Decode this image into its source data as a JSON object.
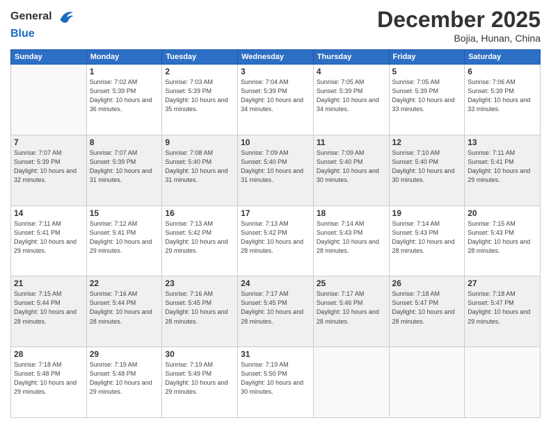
{
  "logo": {
    "general": "General",
    "blue": "Blue"
  },
  "title": {
    "month": "December 2025",
    "location": "Bojia, Hunan, China"
  },
  "weekdays": [
    "Sunday",
    "Monday",
    "Tuesday",
    "Wednesday",
    "Thursday",
    "Friday",
    "Saturday"
  ],
  "weeks": [
    {
      "striped": false,
      "days": [
        {
          "num": "",
          "empty": true,
          "sunrise": "",
          "sunset": "",
          "daylight": ""
        },
        {
          "num": "1",
          "empty": false,
          "sunrise": "Sunrise: 7:02 AM",
          "sunset": "Sunset: 5:39 PM",
          "daylight": "Daylight: 10 hours and 36 minutes."
        },
        {
          "num": "2",
          "empty": false,
          "sunrise": "Sunrise: 7:03 AM",
          "sunset": "Sunset: 5:39 PM",
          "daylight": "Daylight: 10 hours and 35 minutes."
        },
        {
          "num": "3",
          "empty": false,
          "sunrise": "Sunrise: 7:04 AM",
          "sunset": "Sunset: 5:39 PM",
          "daylight": "Daylight: 10 hours and 34 minutes."
        },
        {
          "num": "4",
          "empty": false,
          "sunrise": "Sunrise: 7:05 AM",
          "sunset": "Sunset: 5:39 PM",
          "daylight": "Daylight: 10 hours and 34 minutes."
        },
        {
          "num": "5",
          "empty": false,
          "sunrise": "Sunrise: 7:05 AM",
          "sunset": "Sunset: 5:39 PM",
          "daylight": "Daylight: 10 hours and 33 minutes."
        },
        {
          "num": "6",
          "empty": false,
          "sunrise": "Sunrise: 7:06 AM",
          "sunset": "Sunset: 5:39 PM",
          "daylight": "Daylight: 10 hours and 33 minutes."
        }
      ]
    },
    {
      "striped": true,
      "days": [
        {
          "num": "7",
          "empty": false,
          "sunrise": "Sunrise: 7:07 AM",
          "sunset": "Sunset: 5:39 PM",
          "daylight": "Daylight: 10 hours and 32 minutes."
        },
        {
          "num": "8",
          "empty": false,
          "sunrise": "Sunrise: 7:07 AM",
          "sunset": "Sunset: 5:39 PM",
          "daylight": "Daylight: 10 hours and 31 minutes."
        },
        {
          "num": "9",
          "empty": false,
          "sunrise": "Sunrise: 7:08 AM",
          "sunset": "Sunset: 5:40 PM",
          "daylight": "Daylight: 10 hours and 31 minutes."
        },
        {
          "num": "10",
          "empty": false,
          "sunrise": "Sunrise: 7:09 AM",
          "sunset": "Sunset: 5:40 PM",
          "daylight": "Daylight: 10 hours and 31 minutes."
        },
        {
          "num": "11",
          "empty": false,
          "sunrise": "Sunrise: 7:09 AM",
          "sunset": "Sunset: 5:40 PM",
          "daylight": "Daylight: 10 hours and 30 minutes."
        },
        {
          "num": "12",
          "empty": false,
          "sunrise": "Sunrise: 7:10 AM",
          "sunset": "Sunset: 5:40 PM",
          "daylight": "Daylight: 10 hours and 30 minutes."
        },
        {
          "num": "13",
          "empty": false,
          "sunrise": "Sunrise: 7:11 AM",
          "sunset": "Sunset: 5:41 PM",
          "daylight": "Daylight: 10 hours and 29 minutes."
        }
      ]
    },
    {
      "striped": false,
      "days": [
        {
          "num": "14",
          "empty": false,
          "sunrise": "Sunrise: 7:11 AM",
          "sunset": "Sunset: 5:41 PM",
          "daylight": "Daylight: 10 hours and 29 minutes."
        },
        {
          "num": "15",
          "empty": false,
          "sunrise": "Sunrise: 7:12 AM",
          "sunset": "Sunset: 5:41 PM",
          "daylight": "Daylight: 10 hours and 29 minutes."
        },
        {
          "num": "16",
          "empty": false,
          "sunrise": "Sunrise: 7:13 AM",
          "sunset": "Sunset: 5:42 PM",
          "daylight": "Daylight: 10 hours and 29 minutes."
        },
        {
          "num": "17",
          "empty": false,
          "sunrise": "Sunrise: 7:13 AM",
          "sunset": "Sunset: 5:42 PM",
          "daylight": "Daylight: 10 hours and 28 minutes."
        },
        {
          "num": "18",
          "empty": false,
          "sunrise": "Sunrise: 7:14 AM",
          "sunset": "Sunset: 5:43 PM",
          "daylight": "Daylight: 10 hours and 28 minutes."
        },
        {
          "num": "19",
          "empty": false,
          "sunrise": "Sunrise: 7:14 AM",
          "sunset": "Sunset: 5:43 PM",
          "daylight": "Daylight: 10 hours and 28 minutes."
        },
        {
          "num": "20",
          "empty": false,
          "sunrise": "Sunrise: 7:15 AM",
          "sunset": "Sunset: 5:43 PM",
          "daylight": "Daylight: 10 hours and 28 minutes."
        }
      ]
    },
    {
      "striped": true,
      "days": [
        {
          "num": "21",
          "empty": false,
          "sunrise": "Sunrise: 7:15 AM",
          "sunset": "Sunset: 5:44 PM",
          "daylight": "Daylight: 10 hours and 28 minutes."
        },
        {
          "num": "22",
          "empty": false,
          "sunrise": "Sunrise: 7:16 AM",
          "sunset": "Sunset: 5:44 PM",
          "daylight": "Daylight: 10 hours and 28 minutes."
        },
        {
          "num": "23",
          "empty": false,
          "sunrise": "Sunrise: 7:16 AM",
          "sunset": "Sunset: 5:45 PM",
          "daylight": "Daylight: 10 hours and 28 minutes."
        },
        {
          "num": "24",
          "empty": false,
          "sunrise": "Sunrise: 7:17 AM",
          "sunset": "Sunset: 5:45 PM",
          "daylight": "Daylight: 10 hours and 28 minutes."
        },
        {
          "num": "25",
          "empty": false,
          "sunrise": "Sunrise: 7:17 AM",
          "sunset": "Sunset: 5:46 PM",
          "daylight": "Daylight: 10 hours and 28 minutes."
        },
        {
          "num": "26",
          "empty": false,
          "sunrise": "Sunrise: 7:18 AM",
          "sunset": "Sunset: 5:47 PM",
          "daylight": "Daylight: 10 hours and 28 minutes."
        },
        {
          "num": "27",
          "empty": false,
          "sunrise": "Sunrise: 7:18 AM",
          "sunset": "Sunset: 5:47 PM",
          "daylight": "Daylight: 10 hours and 29 minutes."
        }
      ]
    },
    {
      "striped": false,
      "days": [
        {
          "num": "28",
          "empty": false,
          "sunrise": "Sunrise: 7:18 AM",
          "sunset": "Sunset: 5:48 PM",
          "daylight": "Daylight: 10 hours and 29 minutes."
        },
        {
          "num": "29",
          "empty": false,
          "sunrise": "Sunrise: 7:19 AM",
          "sunset": "Sunset: 5:48 PM",
          "daylight": "Daylight: 10 hours and 29 minutes."
        },
        {
          "num": "30",
          "empty": false,
          "sunrise": "Sunrise: 7:19 AM",
          "sunset": "Sunset: 5:49 PM",
          "daylight": "Daylight: 10 hours and 29 minutes."
        },
        {
          "num": "31",
          "empty": false,
          "sunrise": "Sunrise: 7:19 AM",
          "sunset": "Sunset: 5:50 PM",
          "daylight": "Daylight: 10 hours and 30 minutes."
        },
        {
          "num": "",
          "empty": true,
          "sunrise": "",
          "sunset": "",
          "daylight": ""
        },
        {
          "num": "",
          "empty": true,
          "sunrise": "",
          "sunset": "",
          "daylight": ""
        },
        {
          "num": "",
          "empty": true,
          "sunrise": "",
          "sunset": "",
          "daylight": ""
        }
      ]
    }
  ]
}
